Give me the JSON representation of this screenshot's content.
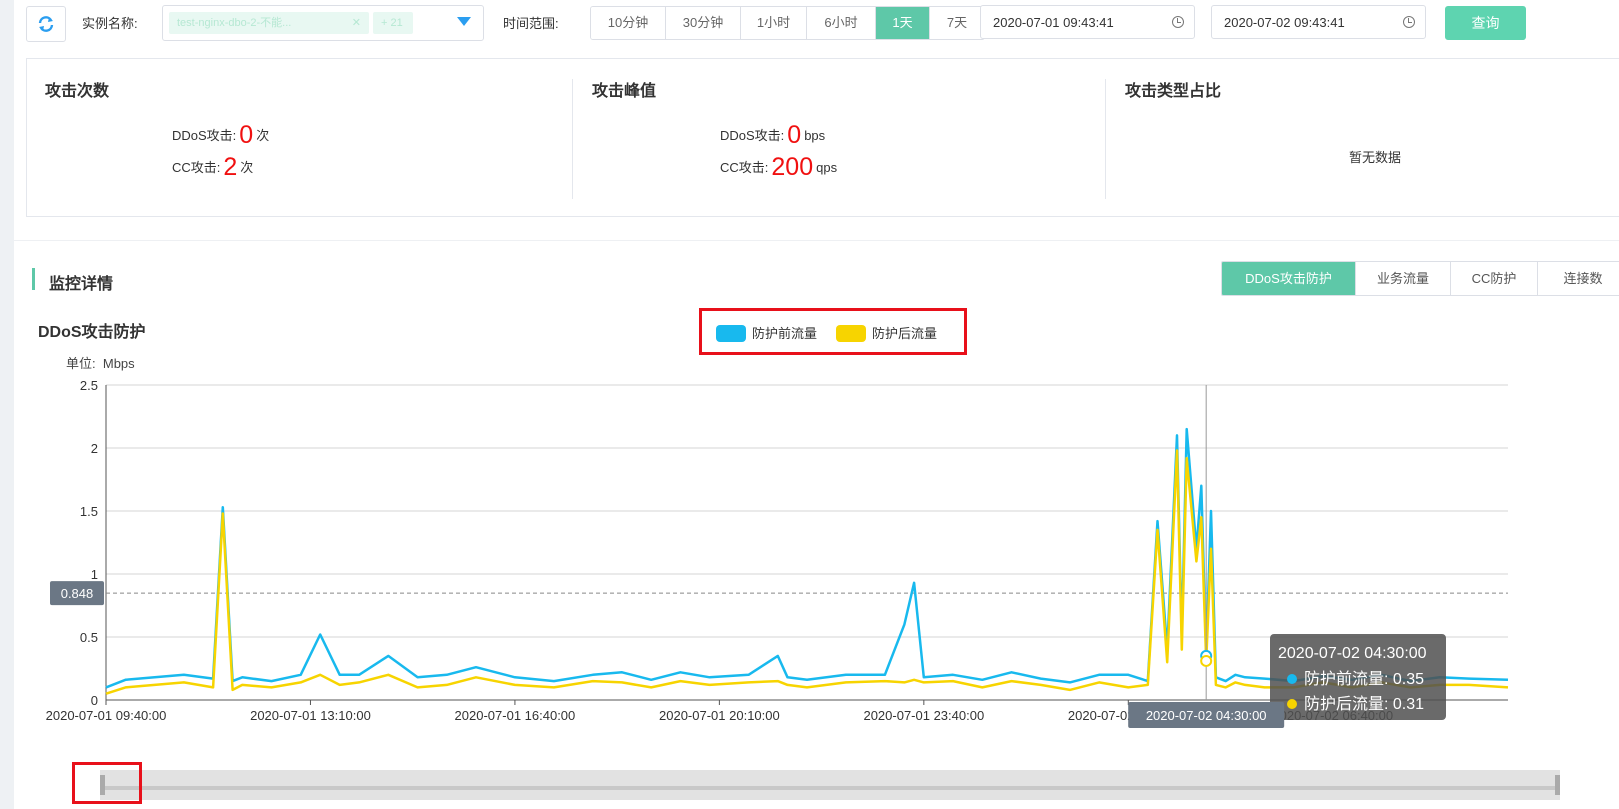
{
  "toolbar": {
    "instance_label": "实例名称:",
    "instance_tag": "test-nginx-dbo-2-不能...",
    "instance_more": "+ 21",
    "range_label": "时间范围:",
    "range_options": [
      "10分钟",
      "30分钟",
      "1小时",
      "6小时",
      "1天",
      "7天"
    ],
    "range_selected": "1天",
    "start_time": "2020-07-01 09:43:41",
    "separator": "-",
    "end_time": "2020-07-02 09:43:41",
    "query_label": "查询"
  },
  "stats": {
    "attack_count": {
      "title": "攻击次数",
      "ddos_label": "DDoS攻击:",
      "ddos_value": "0",
      "ddos_unit": "次",
      "cc_label": "CC攻击:",
      "cc_value": "2",
      "cc_unit": "次"
    },
    "attack_peak": {
      "title": "攻击峰值",
      "ddos_label": "DDoS攻击:",
      "ddos_value": "0",
      "ddos_unit": "bps",
      "cc_label": "CC攻击:",
      "cc_value": "200",
      "cc_unit": "qps"
    },
    "attack_type": {
      "title": "攻击类型占比",
      "empty_text": "暂无数据"
    }
  },
  "monitor": {
    "title": "监控详情",
    "tabs": [
      "DDoS攻击防护",
      "业务流量",
      "CC防护",
      "连接数"
    ],
    "active_tab": "DDoS攻击防护"
  },
  "chart_panel": {
    "title": "DDoS攻击防护",
    "unit_label": "单位:",
    "unit_value": "Mbps"
  },
  "colors": {
    "before": "#18b9ee",
    "after": "#f7d400",
    "accent": "#5ec8a8",
    "highlight": "#e8101a"
  },
  "chart_data": {
    "type": "line",
    "title": "",
    "ylabel": "Mbps",
    "ylim": [
      0,
      2.5
    ],
    "yticks": [
      "0",
      "0.5",
      "1",
      "1.5",
      "2",
      "2.5"
    ],
    "xlim": [
      "2020-07-01 09:40:00",
      "2020-07-02 09:40:00"
    ],
    "xticks": [
      "2020-07-01 09:40:00",
      "2020-07-01 13:10:00",
      "2020-07-01 16:40:00",
      "2020-07-01 20:10:00",
      "2020-07-01 23:40:00",
      "2020-07-02 03:10:00",
      "2020-07-02 06:40:00"
    ],
    "legend_position": "top-center",
    "grid": true,
    "markline": {
      "value": 0.848,
      "label": "0.848"
    },
    "series": [
      {
        "name": "防护前流量",
        "x": [
          "2020-07-01 09:40",
          "2020-07-01 10:00",
          "2020-07-01 10:30",
          "2020-07-01 11:00",
          "2020-07-01 11:30",
          "2020-07-01 11:40",
          "2020-07-01 11:50",
          "2020-07-01 12:00",
          "2020-07-01 12:30",
          "2020-07-01 13:00",
          "2020-07-01 13:20",
          "2020-07-01 13:40",
          "2020-07-01 14:00",
          "2020-07-01 14:30",
          "2020-07-01 15:00",
          "2020-07-01 15:30",
          "2020-07-01 16:00",
          "2020-07-01 16:40",
          "2020-07-01 17:20",
          "2020-07-01 18:00",
          "2020-07-01 18:30",
          "2020-07-01 19:00",
          "2020-07-01 19:30",
          "2020-07-01 20:00",
          "2020-07-01 20:40",
          "2020-07-01 21:10",
          "2020-07-01 21:20",
          "2020-07-01 21:40",
          "2020-07-01 22:20",
          "2020-07-01 23:00",
          "2020-07-01 23:20",
          "2020-07-01 23:30",
          "2020-07-01 23:40",
          "2020-07-02 00:10",
          "2020-07-02 00:40",
          "2020-07-02 01:10",
          "2020-07-02 01:40",
          "2020-07-02 02:10",
          "2020-07-02 02:40",
          "2020-07-02 03:10",
          "2020-07-02 03:30",
          "2020-07-02 03:40",
          "2020-07-02 03:50",
          "2020-07-02 04:00",
          "2020-07-02 04:05",
          "2020-07-02 04:10",
          "2020-07-02 04:20",
          "2020-07-02 04:25",
          "2020-07-02 04:30",
          "2020-07-02 04:35",
          "2020-07-02 04:40",
          "2020-07-02 04:50",
          "2020-07-02 05:00",
          "2020-07-02 05:10",
          "2020-07-02 05:30",
          "2020-07-02 06:00",
          "2020-07-02 06:30",
          "2020-07-02 07:00",
          "2020-07-02 07:30",
          "2020-07-02 08:00",
          "2020-07-02 08:30",
          "2020-07-02 09:00",
          "2020-07-02 09:40"
        ],
        "values": [
          0.1,
          0.16,
          0.18,
          0.2,
          0.17,
          1.53,
          0.15,
          0.18,
          0.15,
          0.2,
          0.52,
          0.2,
          0.2,
          0.35,
          0.18,
          0.2,
          0.26,
          0.18,
          0.15,
          0.2,
          0.22,
          0.16,
          0.22,
          0.18,
          0.2,
          0.35,
          0.18,
          0.16,
          0.2,
          0.2,
          0.6,
          0.93,
          0.18,
          0.2,
          0.16,
          0.22,
          0.17,
          0.14,
          0.2,
          0.2,
          0.15,
          1.42,
          0.4,
          2.1,
          0.5,
          2.15,
          1.2,
          1.7,
          0.35,
          1.5,
          0.18,
          0.15,
          0.2,
          0.18,
          0.17,
          0.15,
          0.19,
          0.16,
          0.2,
          0.15,
          0.18,
          0.17,
          0.16
        ]
      },
      {
        "name": "防护后流量",
        "x": [
          "2020-07-01 09:40",
          "2020-07-01 10:00",
          "2020-07-01 10:30",
          "2020-07-01 11:00",
          "2020-07-01 11:30",
          "2020-07-01 11:40",
          "2020-07-01 11:50",
          "2020-07-01 12:00",
          "2020-07-01 12:30",
          "2020-07-01 13:00",
          "2020-07-01 13:20",
          "2020-07-01 13:40",
          "2020-07-01 14:00",
          "2020-07-01 14:30",
          "2020-07-01 15:00",
          "2020-07-01 15:30",
          "2020-07-01 16:00",
          "2020-07-01 16:40",
          "2020-07-01 17:20",
          "2020-07-01 18:00",
          "2020-07-01 18:30",
          "2020-07-01 19:00",
          "2020-07-01 19:30",
          "2020-07-01 20:00",
          "2020-07-01 20:40",
          "2020-07-01 21:10",
          "2020-07-01 21:20",
          "2020-07-01 21:40",
          "2020-07-01 22:20",
          "2020-07-01 23:00",
          "2020-07-01 23:20",
          "2020-07-01 23:30",
          "2020-07-01 23:40",
          "2020-07-02 00:10",
          "2020-07-02 00:40",
          "2020-07-02 01:10",
          "2020-07-02 01:40",
          "2020-07-02 02:10",
          "2020-07-02 02:40",
          "2020-07-02 03:10",
          "2020-07-02 03:30",
          "2020-07-02 03:40",
          "2020-07-02 03:50",
          "2020-07-02 04:00",
          "2020-07-02 04:05",
          "2020-07-02 04:10",
          "2020-07-02 04:20",
          "2020-07-02 04:25",
          "2020-07-02 04:30",
          "2020-07-02 04:35",
          "2020-07-02 04:40",
          "2020-07-02 04:50",
          "2020-07-02 05:00",
          "2020-07-02 05:10",
          "2020-07-02 05:30",
          "2020-07-02 06:00",
          "2020-07-02 06:30",
          "2020-07-02 07:00",
          "2020-07-02 07:30",
          "2020-07-02 08:00",
          "2020-07-02 08:30",
          "2020-07-02 09:00",
          "2020-07-02 09:40"
        ],
        "values": [
          0.05,
          0.1,
          0.12,
          0.14,
          0.1,
          1.48,
          0.08,
          0.12,
          0.1,
          0.14,
          0.2,
          0.12,
          0.14,
          0.2,
          0.1,
          0.12,
          0.18,
          0.12,
          0.1,
          0.15,
          0.14,
          0.1,
          0.15,
          0.12,
          0.14,
          0.15,
          0.12,
          0.1,
          0.14,
          0.15,
          0.14,
          0.16,
          0.14,
          0.15,
          0.1,
          0.15,
          0.12,
          0.08,
          0.14,
          0.1,
          0.12,
          1.35,
          0.3,
          1.98,
          0.4,
          1.92,
          1.1,
          1.45,
          0.31,
          1.2,
          0.12,
          0.1,
          0.14,
          0.12,
          0.1,
          0.1,
          0.14,
          0.1,
          0.14,
          0.1,
          0.12,
          0.12,
          0.1
        ]
      }
    ],
    "tooltip": {
      "time": "2020-07-02 04:30:00",
      "rows": [
        "防护前流量: 0.35",
        "防护后流量: 0.31"
      ],
      "axis_label": "2020-07-02 04:30:00"
    }
  }
}
